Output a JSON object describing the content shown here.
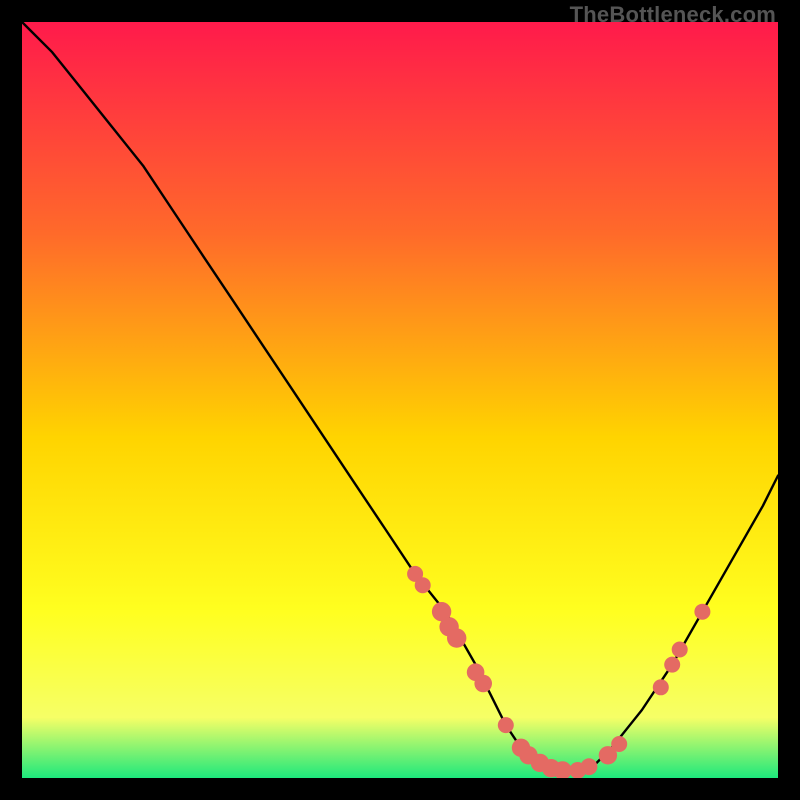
{
  "watermark": "TheBottleneck.com",
  "colors": {
    "gradient_top": "#ff1a4b",
    "gradient_mid1": "#ff6a2a",
    "gradient_mid2": "#ffd400",
    "gradient_mid3": "#ffff20",
    "gradient_bottom_yellow": "#f6ff66",
    "gradient_green": "#1de87c",
    "curve": "#000000",
    "marker": "#e46a63"
  },
  "chart_data": {
    "type": "line",
    "title": "",
    "xlabel": "",
    "ylabel": "",
    "xlim": [
      0,
      100
    ],
    "ylim": [
      0,
      100
    ],
    "grid": false,
    "legend": false,
    "series": [
      {
        "name": "bottleneck-curve",
        "x": [
          0,
          4,
          8,
          12,
          16,
          20,
          24,
          28,
          32,
          36,
          40,
          44,
          48,
          52,
          56,
          60,
          62,
          64,
          66,
          68,
          70,
          72,
          74,
          76,
          78,
          82,
          86,
          90,
          94,
          98,
          100
        ],
        "y": [
          100,
          96,
          91,
          86,
          81,
          75,
          69,
          63,
          57,
          51,
          45,
          39,
          33,
          27,
          22,
          15,
          11,
          7,
          4,
          2,
          1,
          1,
          1,
          2,
          4,
          9,
          15,
          22,
          29,
          36,
          40
        ]
      }
    ],
    "markers": [
      {
        "x": 52.0,
        "y": 27.0,
        "r": 1.2
      },
      {
        "x": 53.0,
        "y": 25.5,
        "r": 1.2
      },
      {
        "x": 55.5,
        "y": 22.0,
        "r": 1.6
      },
      {
        "x": 56.5,
        "y": 20.0,
        "r": 1.6
      },
      {
        "x": 57.5,
        "y": 18.5,
        "r": 1.6
      },
      {
        "x": 60.0,
        "y": 14.0,
        "r": 1.4
      },
      {
        "x": 61.0,
        "y": 12.5,
        "r": 1.4
      },
      {
        "x": 64.0,
        "y": 7.0,
        "r": 1.2
      },
      {
        "x": 66.0,
        "y": 4.0,
        "r": 1.5
      },
      {
        "x": 67.0,
        "y": 3.0,
        "r": 1.5
      },
      {
        "x": 68.5,
        "y": 2.0,
        "r": 1.5
      },
      {
        "x": 70.0,
        "y": 1.3,
        "r": 1.5
      },
      {
        "x": 71.5,
        "y": 1.0,
        "r": 1.5
      },
      {
        "x": 73.5,
        "y": 1.0,
        "r": 1.3
      },
      {
        "x": 75.0,
        "y": 1.5,
        "r": 1.3
      },
      {
        "x": 77.5,
        "y": 3.0,
        "r": 1.5
      },
      {
        "x": 79.0,
        "y": 4.5,
        "r": 1.2
      },
      {
        "x": 84.5,
        "y": 12.0,
        "r": 1.2
      },
      {
        "x": 86.0,
        "y": 15.0,
        "r": 1.2
      },
      {
        "x": 87.0,
        "y": 17.0,
        "r": 1.2
      },
      {
        "x": 90.0,
        "y": 22.0,
        "r": 1.2
      }
    ]
  }
}
